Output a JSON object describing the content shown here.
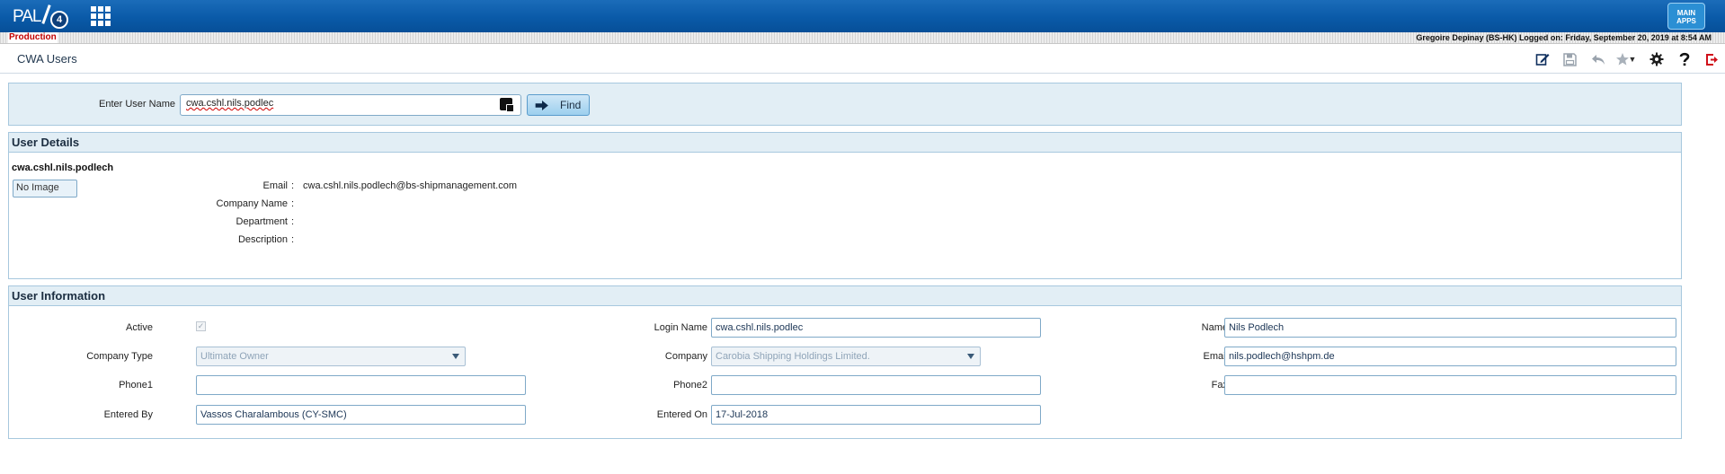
{
  "app": {
    "logo_text": "PAL",
    "logo_version": "4",
    "apps_badge": "MAIN APPS",
    "environment": "Production",
    "session_status": "Gregoire Depinay (BS-HK) Logged on: Friday, September 20, 2019 at 8:54 AM"
  },
  "page": {
    "title": "CWA Users"
  },
  "toolbar": {
    "icons": [
      "edit-icon",
      "save-icon",
      "undo-icon",
      "favorite-star-icon",
      "settings-gear-icon",
      "help-icon",
      "logout-icon"
    ]
  },
  "search": {
    "label": "Enter User Name",
    "value": "cwa.cshl.nils.podlec",
    "find_label": "Find"
  },
  "user_details": {
    "section_title": "User Details",
    "username": "cwa.cshl.nils.podlech",
    "image_alt": "No Image",
    "rows": [
      {
        "label": "Email",
        "value": "cwa.cshl.nils.podlech@bs-shipmanagement.com"
      },
      {
        "label": "Company Name",
        "value": ""
      },
      {
        "label": "Department",
        "value": ""
      },
      {
        "label": "Description",
        "value": ""
      }
    ]
  },
  "user_information": {
    "section_title": "User Information",
    "active_label": "Active",
    "active_checked": true,
    "company_type_label": "Company Type",
    "company_type_value": "Ultimate Owner",
    "phone1_label": "Phone1",
    "phone1_value": "",
    "entered_by_label": "Entered By",
    "entered_by_value": "Vassos Charalambous (CY-SMC)",
    "login_name_label": "Login Name",
    "login_name_value": "cwa.cshl.nils.podlec",
    "company_label": "Company",
    "company_value": "Carobia Shipping Holdings Limited.",
    "phone2_label": "Phone2",
    "phone2_value": "",
    "entered_on_label": "Entered On",
    "entered_on_value": "17-Jul-2018",
    "name_label": "Name",
    "name_value": "Nils Podlech",
    "email_label": "Email",
    "email_value": "nils.podlech@hshpm.de",
    "fax_label": "Fax",
    "fax_value": ""
  }
}
